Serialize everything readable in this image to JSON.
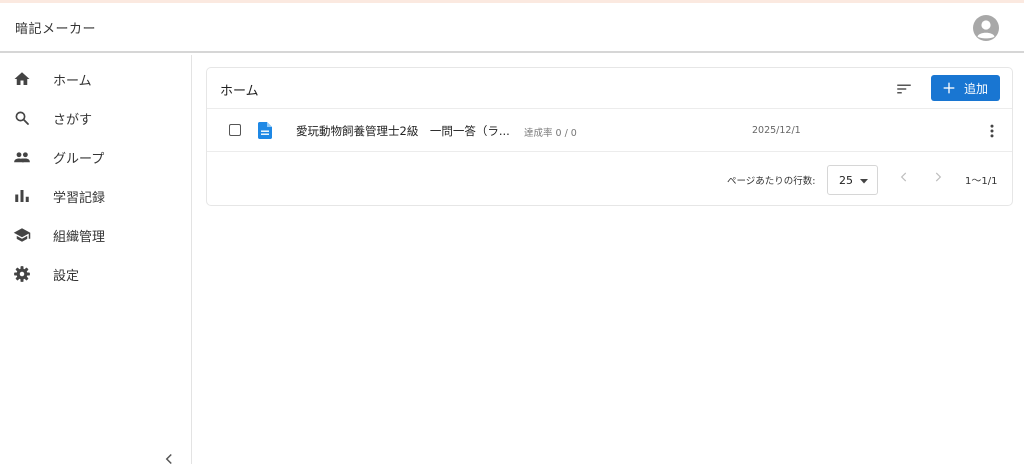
{
  "app": {
    "title": "暗記メーカー",
    "accent_color": "#1976d2",
    "avatar_icon": "account-circle-icon"
  },
  "sidebar": {
    "items": [
      {
        "label": "ホーム",
        "icon": "home-icon"
      },
      {
        "label": "さがす",
        "icon": "search-icon"
      },
      {
        "label": "グループ",
        "icon": "group-icon"
      },
      {
        "label": "学習記録",
        "icon": "bar-chart-icon"
      },
      {
        "label": "組織管理",
        "icon": "school-icon"
      },
      {
        "label": "設定",
        "icon": "gear-icon"
      }
    ],
    "collapse_icon": "chevron-left-icon"
  },
  "main": {
    "title": "ホーム",
    "sort_icon": "sort-icon",
    "add_button": {
      "label": "追加",
      "icon": "plus-icon"
    },
    "rows": [
      {
        "title": "愛玩動物飼養管理士2級　一問一答（ラ...",
        "rate": "達成率 0 / 0",
        "date": "2025/12/1",
        "icon": "document-icon",
        "checked": false
      }
    ],
    "pagination": {
      "rows_per_page_label": "ページあたりの行数:",
      "rows_per_page": "25",
      "range": "1〜1/1"
    }
  }
}
